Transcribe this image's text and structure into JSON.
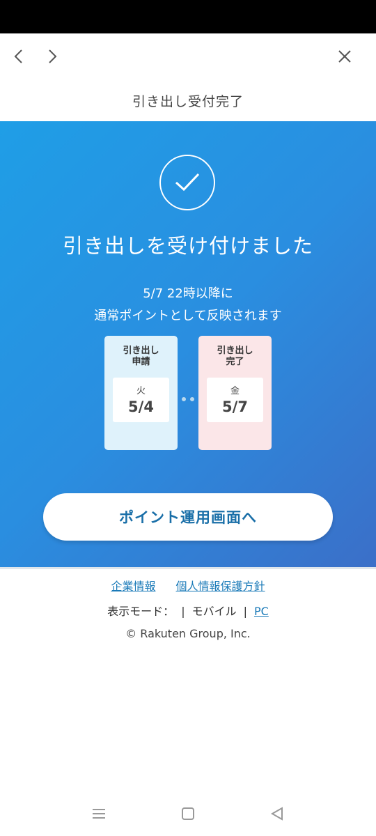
{
  "page": {
    "title": "引き出し受付完了"
  },
  "nav": {
    "back_icon": "chevron-left-icon",
    "forward_icon": "chevron-right-icon",
    "close_icon": "close-icon"
  },
  "hero": {
    "title": "引き出しを受け付けました",
    "subtitle_line1": "5/7 22時以降に",
    "subtitle_line2": "通常ポイントとして反映されます",
    "steps": [
      {
        "label_line1": "引き出し",
        "label_line2": "申請",
        "day_of_week": "火",
        "date": "5/4"
      },
      {
        "label_line1": "引き出し",
        "label_line2": "完了",
        "day_of_week": "金",
        "date": "5/7"
      }
    ],
    "cta_label": "ポイント運用画面へ"
  },
  "footer": {
    "links": [
      "企業情報",
      "個人情報保護方針"
    ],
    "mode_label": "表示モード：",
    "mode_mobile": "モバイル",
    "mode_pc": "PC",
    "copyright": "© Rakuten Group, Inc."
  },
  "colors": {
    "accent": "#1a6fa8",
    "hero_start": "#1f9ee6",
    "hero_end": "#3b6fc8"
  }
}
